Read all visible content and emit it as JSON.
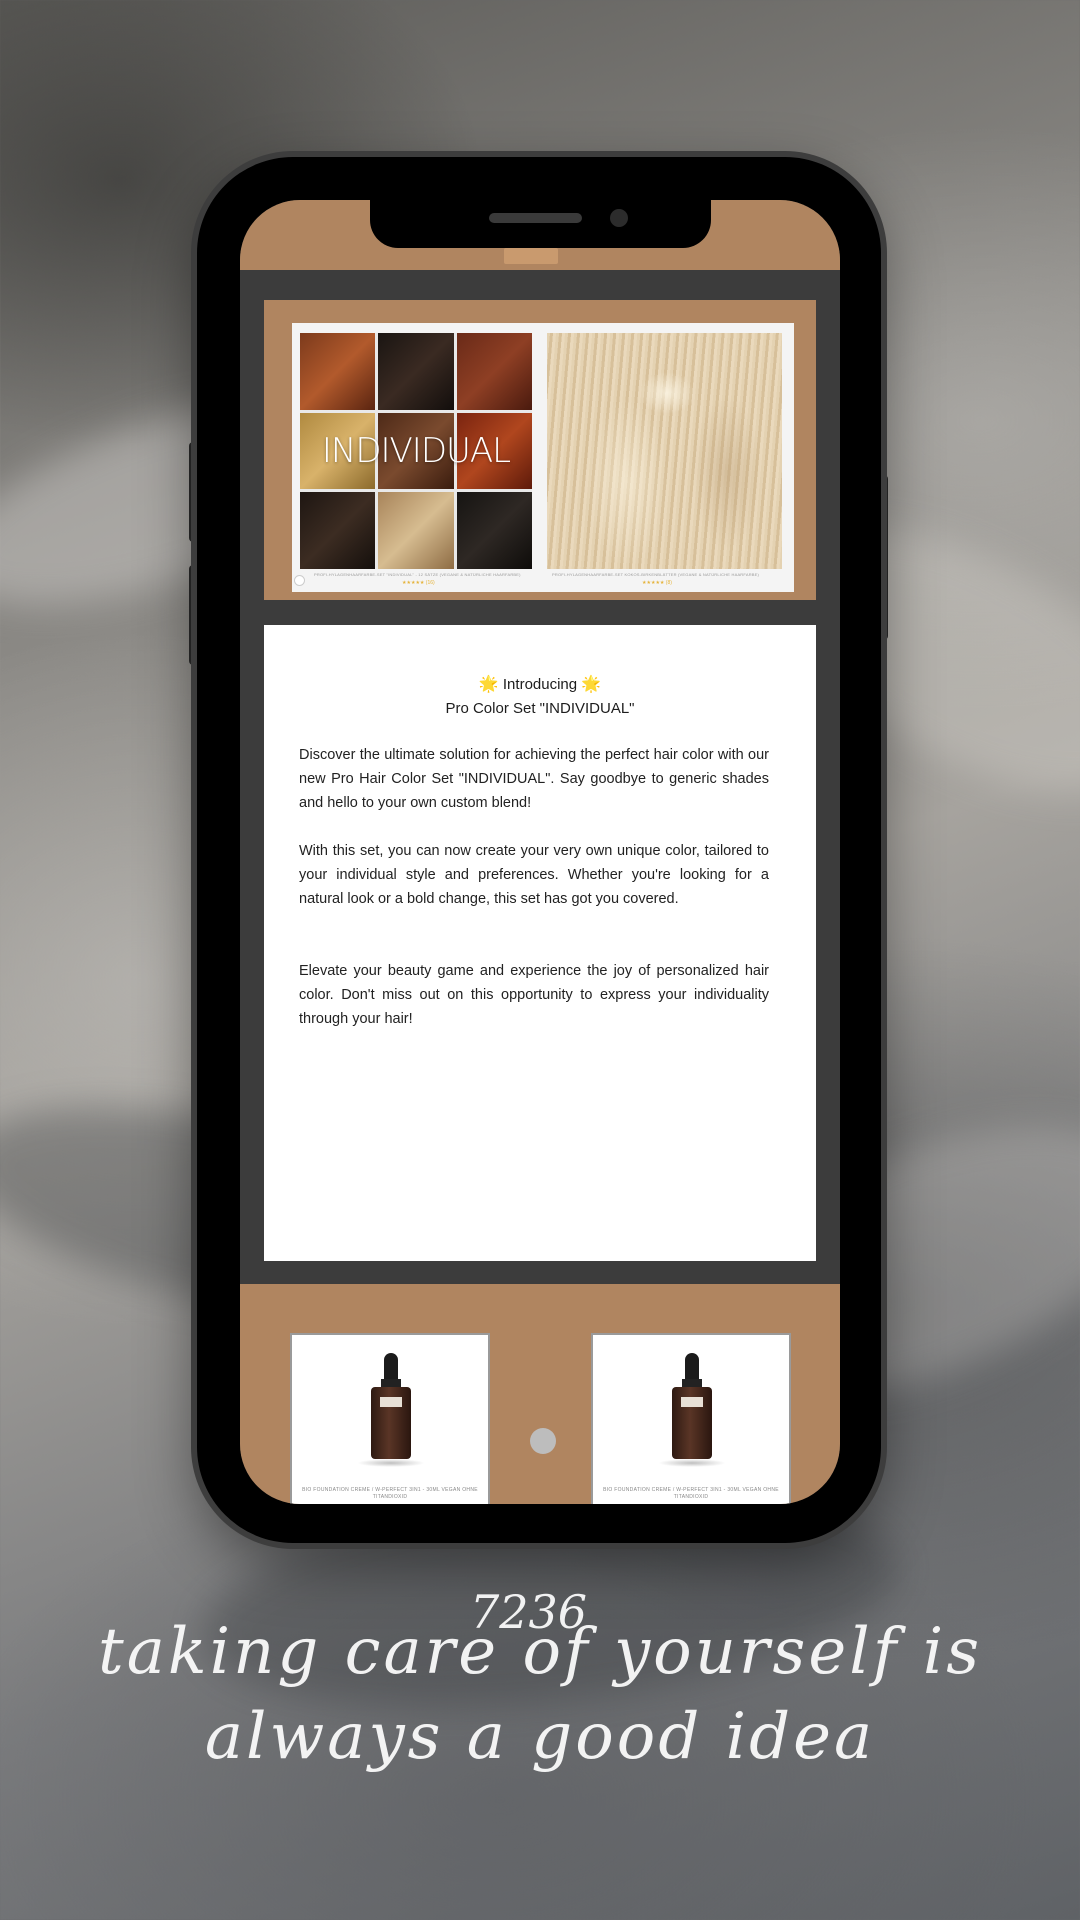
{
  "banner": {
    "grid_word": "INDIVIDUAL",
    "caption_left": "PROFI-HYLAGENHAARFARBE-SET \"INDIVIDUAL\" - 12 SÄTZE (VEGANE & NATÜRLICHE HAARFARBE)",
    "caption_right": "PROFI-HYLAGENHAARFARBE-SET KOKOS-BIRKENBLÄTTER (VEGANE & NATÜRLICHE HAARFARBE)",
    "stars_left": "★★★★★ (16)",
    "stars_right": "★★★★★ (8)"
  },
  "card": {
    "intro_line1": "Introducing",
    "intro_line2": "Pro Color Set \"INDIVIDUAL\"",
    "sun_glyph": "🌟",
    "paragraph1": "Discover the ultimate solution for achieving the perfect hair color with our new Pro Hair Color Set \"INDIVIDUAL\". Say goodbye to generic shades and hello to your own custom blend!",
    "paragraph2": "With this set, you can now create your very own unique color, tailored to your individual style and preferences. Whether you're looking for a natural look or a bold change, this set has got you covered.",
    "paragraph3": "Elevate your beauty game and experience the joy of personalized hair color. Don't miss out on this opportunity to express your individuality through your hair!"
  },
  "products": [
    {
      "caption": "BIO FOUNDATION CREME / W-PERFECT 3IN1 - 30ML VEGAN OHNE TITANDIOXID"
    },
    {
      "caption": "BIO FOUNDATION CREME / W-PERFECT 3IN1 - 30ML VEGAN OHNE TITANDIOXID"
    }
  ],
  "overlay": {
    "number": "7236",
    "script_line1": "taking care of yourself is",
    "script_line2": "always a good idea"
  },
  "colors": {
    "accent": "#b08560",
    "screen_bg": "#3c3c3c",
    "star": "#e5b33a"
  }
}
